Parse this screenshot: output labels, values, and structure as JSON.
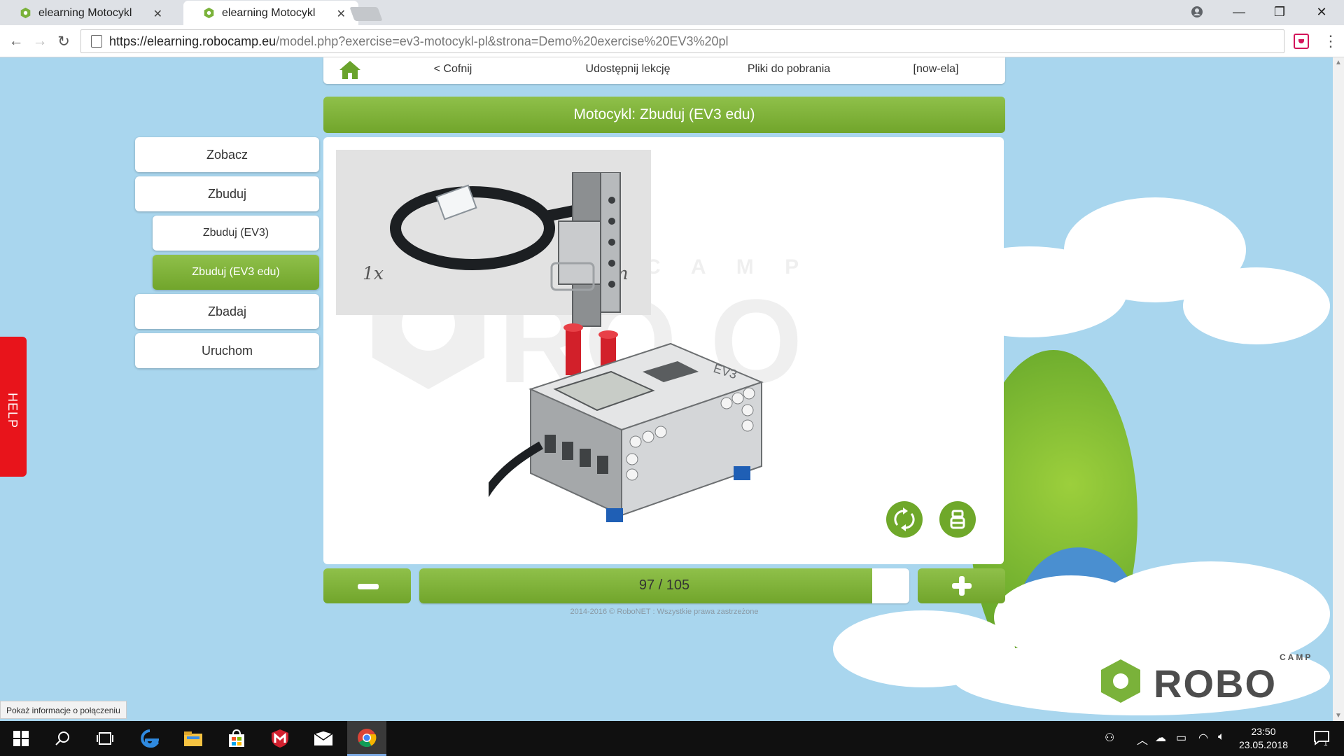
{
  "browser": {
    "tabs": [
      {
        "title": "elearning Motocykl",
        "close": "✕"
      },
      {
        "title": "elearning Motocykl",
        "close": "✕"
      }
    ],
    "window_controls": {
      "minimize": "—",
      "restore": "❐",
      "close": "✕"
    },
    "address": {
      "host": "https://elearning.robocamp.eu",
      "rest": "/model.php?exercise=ev3-motocykl-pl&strona=Demo%20exercise%20EV3%20pl"
    },
    "nav_icons": {
      "back": "back-arrow-icon",
      "forward": "forward-arrow-icon",
      "reload": "reload-icon"
    }
  },
  "app_nav": {
    "back": "< Cofnij",
    "share": "Udostępnij lekcję",
    "downloads": "Pliki do pobrania",
    "user": "[now-ela]"
  },
  "page_title": "Motocykl: Zbuduj (EV3 edu)",
  "side_menu": {
    "see": "Zobacz",
    "build": "Zbuduj",
    "build_ev3": "Zbuduj (EV3)",
    "build_ev3_edu": "Zbuduj (EV3 edu)",
    "explore": "Zbadaj",
    "run": "Uruchom"
  },
  "part": {
    "count": "1x",
    "length": "25cm"
  },
  "stepper": {
    "label": "97 / 105",
    "current": 97,
    "total": 105
  },
  "footer": "2014-2016 © RoboNET : Wszystkie prawa zastrzeżone",
  "help": "HELP",
  "status_bubble": "Pokaż informacje o połączeniu",
  "logo": {
    "camp": "CAMP",
    "robo": "ROBO"
  },
  "watermark": {
    "camp": "C A M P",
    "robo": "RO O"
  },
  "ev3_label": "EV3",
  "taskbar": {
    "time": "23:50",
    "date": "23.05.2018",
    "notifications": "1"
  },
  "colors": {
    "accent_green": "#7ab23a",
    "help_red": "#e8141b",
    "sky": "#a9d6ee"
  }
}
